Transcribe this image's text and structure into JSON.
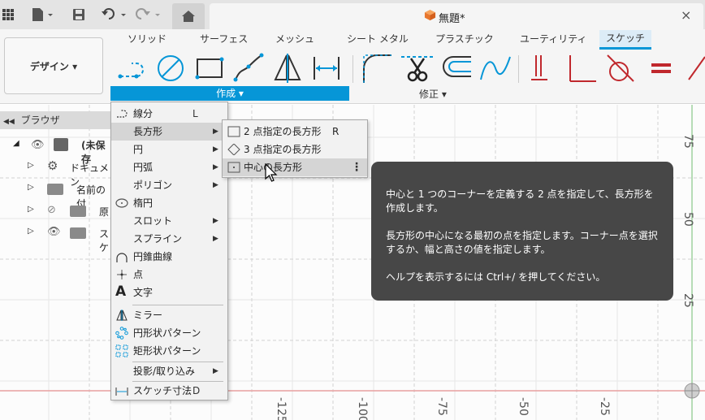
{
  "titlebar": {
    "doc_title": "無題*",
    "close": "×"
  },
  "ribbon": {
    "design_button": "デザイン ▾",
    "tabs": [
      "ソリッド",
      "サーフェス",
      "メッシュ",
      "シート メタル",
      "プラスチック",
      "ユーティリティ",
      "スケッチ"
    ],
    "active_tab": "スケッチ",
    "create_label": "作成 ▾",
    "modify_label": "修正 ▾",
    "accent_color": "#0696d7"
  },
  "browser": {
    "title": "ブラウザ",
    "rows": [
      "(未保存",
      "ドキュメン",
      "名前の付",
      "原",
      "スケ"
    ]
  },
  "menu": {
    "items": [
      {
        "label": "線分",
        "shortcut": "L"
      },
      {
        "label": "長方形",
        "submenu": true
      },
      {
        "label": "円",
        "submenu": true
      },
      {
        "label": "円弧",
        "submenu": true
      },
      {
        "label": "ポリゴン",
        "submenu": true
      },
      {
        "label": "楕円"
      },
      {
        "label": "スロット",
        "submenu": true
      },
      {
        "label": "スプライン",
        "submenu": true
      },
      {
        "label": "円錐曲線"
      },
      {
        "label": "点"
      },
      {
        "label": "文字"
      },
      {
        "label": "ミラー"
      },
      {
        "label": "円形状パターン"
      },
      {
        "label": "矩形状パターン"
      },
      {
        "label": "投影/取り込み",
        "submenu": true
      },
      {
        "label": "スケッチ寸法",
        "shortcut": "D"
      }
    ],
    "submenu_arrow": "▶"
  },
  "submenu": {
    "items": [
      {
        "label": "2 点指定の長方形",
        "shortcut": "R"
      },
      {
        "label": "3 点指定の長方形",
        "shortcut": ""
      },
      {
        "label": "中心の長方形",
        "shortcut": ""
      }
    ],
    "kebab": "⋮"
  },
  "tooltip": {
    "line1": "中心と 1 つのコーナーを定義する 2 点を指定して、長方形を作成します。",
    "line2": "長方形の中心になる最初の点を指定します。コーナー点を選択するか、幅と高さの値を指定します。",
    "line3": "ヘルプを表示するには Ctrl+/ を押してください。"
  },
  "axes": {
    "right_labels": [
      "75",
      "50",
      "25"
    ],
    "bottom_labels": [
      "-125",
      "-100",
      "-75",
      "-50",
      "-25"
    ]
  }
}
